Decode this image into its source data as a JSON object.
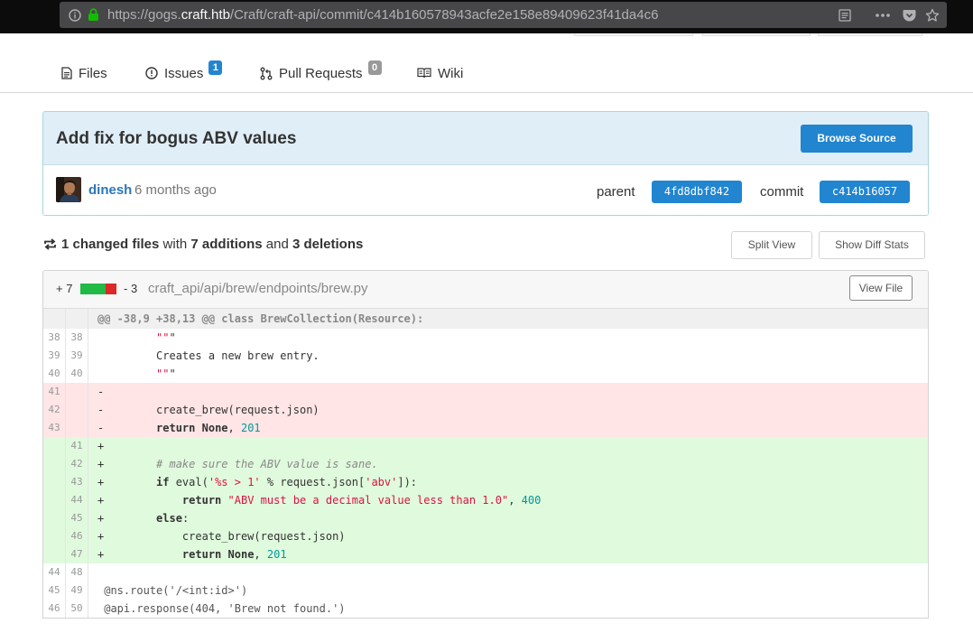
{
  "browser": {
    "url_prefix": "https://gogs.",
    "url_host": "craft.htb",
    "url_path": "/Craft/craft-api/commit/c414b160578943acfe2e158e89409623f41da4c6"
  },
  "tabs": [
    {
      "label": "Files"
    },
    {
      "label": "Issues",
      "count": "1"
    },
    {
      "label": "Pull Requests",
      "count": "0"
    },
    {
      "label": "Wiki"
    }
  ],
  "commit": {
    "title": "Add fix for bogus ABV values",
    "browse_label": "Browse Source",
    "author": "dinesh",
    "time": "6 months ago",
    "parent_label": "parent",
    "parent_sha": "4fd8dbf842",
    "commit_label": "commit",
    "commit_sha": "c414b16057"
  },
  "stats": {
    "files": "1 changed files",
    "with": "with",
    "additions": "7 additions",
    "and": "and",
    "deletions": "3 deletions",
    "split_label": "Split View",
    "diffstats_label": "Show Diff Stats"
  },
  "colors": {
    "primary": "#2185d0",
    "add_bg": "#e0fadd",
    "del_bg": "#ffe5e5"
  },
  "file": {
    "additions": "+ 7",
    "deletions": "- 3",
    "path": "craft_api/api/brew/endpoints/brew.py",
    "view_label": "View File",
    "hunk": "@@ -38,9 +38,13 @@ class BrewCollection(Resource):",
    "lines": [
      {
        "type": "ctx",
        "old": "38",
        "new": "38",
        "prefix": " ",
        "text": "        \"\"\""
      },
      {
        "type": "ctx",
        "old": "39",
        "new": "39",
        "prefix": " ",
        "text": "        Creates a new brew entry."
      },
      {
        "type": "ctx",
        "old": "40",
        "new": "40",
        "prefix": " ",
        "text": "        \"\"\""
      },
      {
        "type": "del",
        "old": "41",
        "new": "",
        "prefix": "-",
        "text": ""
      },
      {
        "type": "del",
        "old": "42",
        "new": "",
        "prefix": "-",
        "text": "        create_brew(request.json)"
      },
      {
        "type": "del",
        "old": "43",
        "new": "",
        "prefix": "-",
        "text": "        return None, 201"
      },
      {
        "type": "add",
        "old": "",
        "new": "41",
        "prefix": "+",
        "text": ""
      },
      {
        "type": "add",
        "old": "",
        "new": "42",
        "prefix": "+",
        "text": "        # make sure the ABV value is sane."
      },
      {
        "type": "add",
        "old": "",
        "new": "43",
        "prefix": "+",
        "text": "        if eval('%s > 1' % request.json['abv']):"
      },
      {
        "type": "add",
        "old": "",
        "new": "44",
        "prefix": "+",
        "text": "            return \"ABV must be a decimal value less than 1.0\", 400"
      },
      {
        "type": "add",
        "old": "",
        "new": "45",
        "prefix": "+",
        "text": "        else:"
      },
      {
        "type": "add",
        "old": "",
        "new": "46",
        "prefix": "+",
        "text": "            create_brew(request.json)"
      },
      {
        "type": "add",
        "old": "",
        "new": "47",
        "prefix": "+",
        "text": "            return None, 201"
      },
      {
        "type": "ctx",
        "old": "44",
        "new": "48",
        "prefix": " ",
        "text": ""
      },
      {
        "type": "ctx",
        "old": "45",
        "new": "49",
        "prefix": " ",
        "text": "@ns.route('/<int:id>')"
      },
      {
        "type": "ctx",
        "old": "46",
        "new": "50",
        "prefix": " ",
        "text": "@api.response(404, 'Brew not found.')"
      }
    ]
  }
}
